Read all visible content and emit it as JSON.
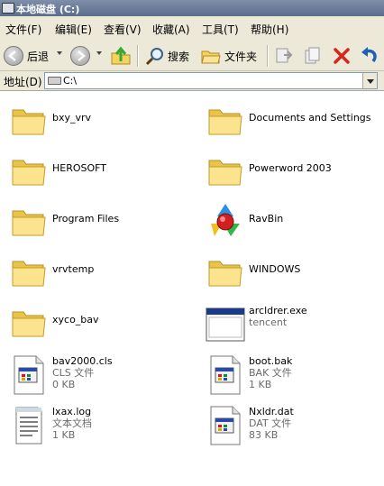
{
  "window": {
    "title": "本地磁盘 (C:)"
  },
  "menu": [
    "文件(F)",
    "编辑(E)",
    "查看(V)",
    "收藏(A)",
    "工具(T)",
    "帮助(H)"
  ],
  "toolbar": {
    "back_label": "后退",
    "search_label": "搜索",
    "folders_label": "文件夹"
  },
  "address": {
    "label": "地址(D)",
    "value": "C:\\"
  },
  "items": [
    {
      "name": "bxy_vrv",
      "kind": "folder"
    },
    {
      "name": "Documents and Settings",
      "kind": "folder"
    },
    {
      "name": "HEROSOFT",
      "kind": "folder"
    },
    {
      "name": "Powerword 2003",
      "kind": "folder"
    },
    {
      "name": "Program Files",
      "kind": "folder"
    },
    {
      "name": "RavBin",
      "kind": "rav"
    },
    {
      "name": "vrvtemp",
      "kind": "folder"
    },
    {
      "name": "WINDOWS",
      "kind": "folder"
    },
    {
      "name": "xyco_bav",
      "kind": "folder"
    },
    {
      "name": "arcldrer.exe",
      "kind": "exe",
      "type": "tencent"
    },
    {
      "name": "bav2000.cls",
      "kind": "file",
      "type": "CLS 文件",
      "size": "0 KB"
    },
    {
      "name": "boot.bak",
      "kind": "file",
      "type": "BAK 文件",
      "size": "1 KB"
    },
    {
      "name": "lxax.log",
      "kind": "text",
      "type": "文本文档",
      "size": "1 KB"
    },
    {
      "name": "Nxldr.dat",
      "kind": "file",
      "type": "DAT 文件",
      "size": "83 KB"
    }
  ]
}
